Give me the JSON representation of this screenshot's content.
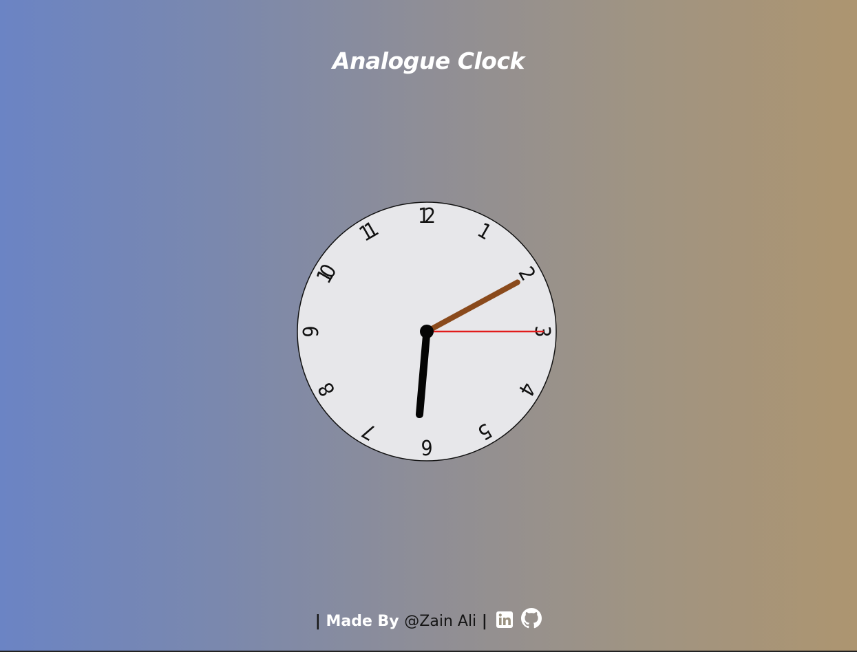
{
  "header": {
    "title": "Analogue Clock"
  },
  "clock": {
    "numerals": [
      "12",
      "1",
      "2",
      "3",
      "4",
      "5",
      "6",
      "7",
      "8",
      "9",
      "10",
      "11"
    ],
    "time": {
      "hours": 6,
      "minutes": 10,
      "seconds": 15
    },
    "colors": {
      "face": "#e7e7ea",
      "border": "#111111",
      "hour_hand": "#050505",
      "minute_hand": "#8a4a1c",
      "second_hand": "#e11b1b",
      "center_dot": "#050505"
    }
  },
  "footer": {
    "prefix": "| ",
    "made_by": "Made By ",
    "author": "@Zain Ali",
    "separator": " |",
    "links": [
      {
        "name": "linkedin-icon"
      },
      {
        "name": "github-icon"
      }
    ]
  },
  "colors": {
    "gradient_left": "#6b84c4",
    "gradient_right": "#ad9570"
  }
}
